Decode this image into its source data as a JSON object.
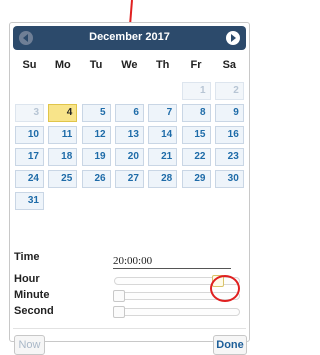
{
  "header": {
    "title": "December 2017"
  },
  "days_of_week": [
    "Su",
    "Mo",
    "Tu",
    "We",
    "Th",
    "Fr",
    "Sa"
  ],
  "weeks": [
    [
      {
        "day": ""
      },
      {
        "day": ""
      },
      {
        "day": ""
      },
      {
        "day": ""
      },
      {
        "day": ""
      },
      {
        "day": "1",
        "other": true
      },
      {
        "day": "2",
        "other": true
      }
    ],
    [
      {
        "day": "3",
        "other": true
      },
      {
        "day": "4",
        "today": true
      },
      {
        "day": "5"
      },
      {
        "day": "6"
      },
      {
        "day": "7"
      },
      {
        "day": "8"
      },
      {
        "day": "9"
      }
    ],
    [
      {
        "day": "10"
      },
      {
        "day": "11"
      },
      {
        "day": "12"
      },
      {
        "day": "13"
      },
      {
        "day": "14"
      },
      {
        "day": "15"
      },
      {
        "day": "16"
      }
    ],
    [
      {
        "day": "17"
      },
      {
        "day": "18"
      },
      {
        "day": "19"
      },
      {
        "day": "20"
      },
      {
        "day": "21"
      },
      {
        "day": "22"
      },
      {
        "day": "23"
      }
    ],
    [
      {
        "day": "24"
      },
      {
        "day": "25"
      },
      {
        "day": "26"
      },
      {
        "day": "27"
      },
      {
        "day": "28"
      },
      {
        "day": "29"
      },
      {
        "day": "30"
      }
    ],
    [
      {
        "day": "31"
      },
      {
        "day": ""
      },
      {
        "day": ""
      },
      {
        "day": ""
      },
      {
        "day": ""
      },
      {
        "day": ""
      },
      {
        "day": ""
      }
    ]
  ],
  "time": {
    "label": "Time",
    "value": "20:00:00"
  },
  "sliders": {
    "hour": {
      "label": "Hour",
      "level": 20,
      "max": 23
    },
    "minute": {
      "label": "Minute",
      "level": 0,
      "max": 59
    },
    "second": {
      "label": "Second",
      "level": 0,
      "max": 59
    }
  },
  "buttons": {
    "now": "Now",
    "done": "Done"
  },
  "colors": {
    "header": "#2c4a6b",
    "today": "#f8e48a",
    "link": "#1e6ba8",
    "annotation": "#e02020"
  }
}
